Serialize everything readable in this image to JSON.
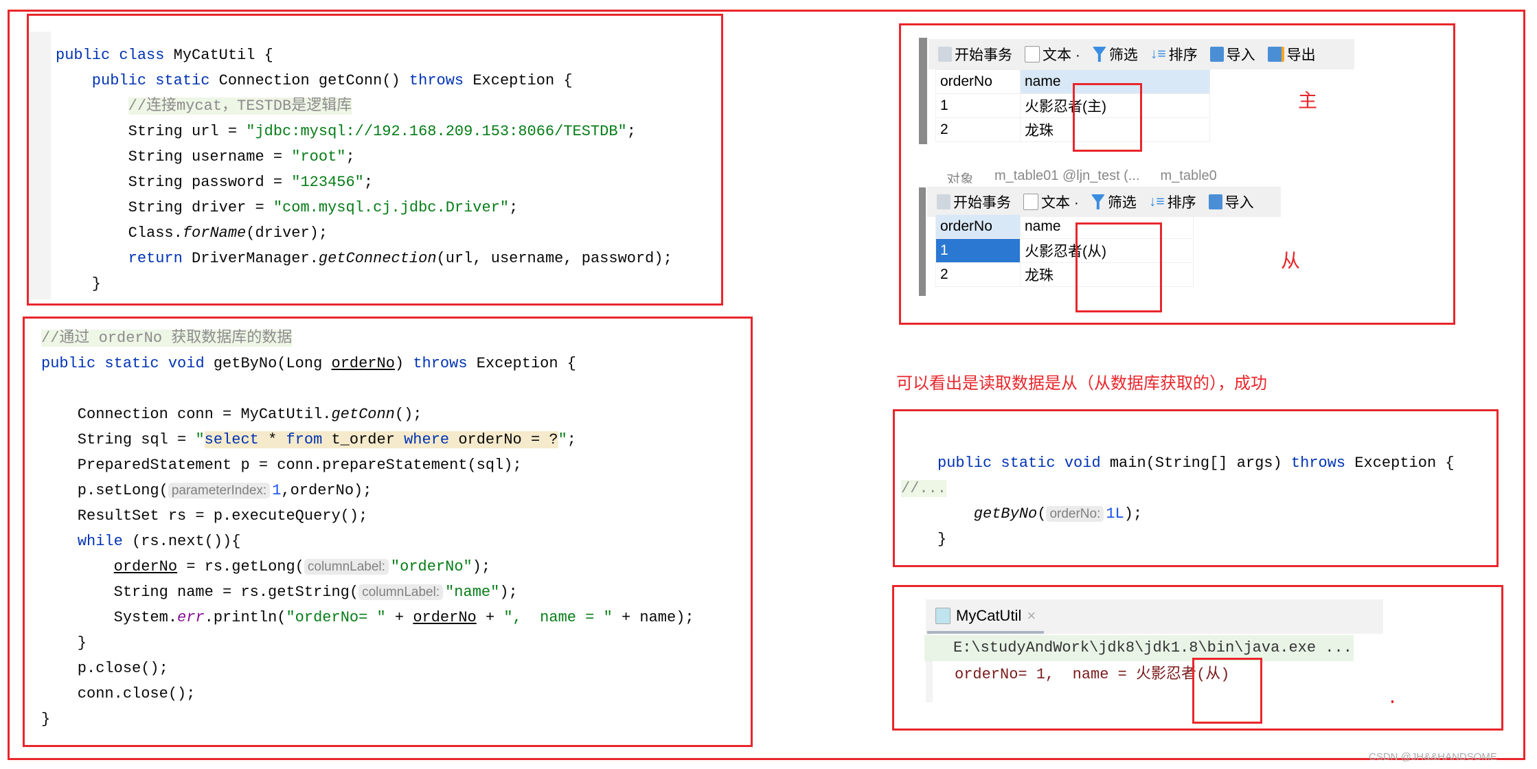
{
  "code1": [
    [
      [
        "public ",
        "kw"
      ],
      [
        "class ",
        "kw"
      ],
      [
        "MyCatUtil {",
        ""
      ]
    ],
    [
      [
        "    public ",
        "kw"
      ],
      [
        "static ",
        "kw"
      ],
      [
        "Connection ",
        ""
      ],
      [
        "getConn",
        "",
        ""
      ],
      [
        "() ",
        ""
      ],
      [
        "throws ",
        "kw"
      ],
      [
        "Exception {",
        ""
      ]
    ],
    [
      [
        "        ",
        ""
      ],
      [
        "//连接mycat，TESTDB是逻辑库",
        "cm cmbg"
      ]
    ],
    [
      [
        "        String url = ",
        ""
      ],
      [
        "\"jdbc:mysql://192.168.209.153:8066/TESTDB\"",
        "str"
      ],
      [
        ";",
        ""
      ]
    ],
    [
      [
        "        String username = ",
        ""
      ],
      [
        "\"root\"",
        "str"
      ],
      [
        ";",
        ""
      ]
    ],
    [
      [
        "        String password = ",
        ""
      ],
      [
        "\"123456\"",
        "str"
      ],
      [
        ";",
        ""
      ]
    ],
    [
      [
        "        String driver = ",
        ""
      ],
      [
        "\"com.mysql.cj.jdbc.Driver\"",
        "str"
      ],
      [
        ";",
        ""
      ]
    ],
    [
      [
        "        Class.",
        ""
      ],
      [
        "forName",
        "it"
      ],
      [
        "(driver);",
        ""
      ]
    ],
    [
      [
        "        ",
        ""
      ],
      [
        "return ",
        "kw"
      ],
      [
        "DriverManager.",
        ""
      ],
      [
        "getConnection",
        "it"
      ],
      [
        "(url, username, password);",
        ""
      ]
    ],
    [
      [
        "    }",
        ""
      ]
    ]
  ],
  "code2": [
    [
      [
        "//通过 orderNo 获取数据库的数据",
        "cm cmbg"
      ]
    ],
    [
      [
        "public ",
        "kw"
      ],
      [
        "static ",
        "kw"
      ],
      [
        "void ",
        "kw"
      ],
      [
        "getByNo(Long ",
        ""
      ],
      [
        "orderNo",
        "ul"
      ],
      [
        ") ",
        ""
      ],
      [
        "throws ",
        "kw"
      ],
      [
        "Exception {",
        ""
      ]
    ],
    [
      [
        "",
        ""
      ]
    ],
    [
      [
        "    Connection conn = MyCatUtil.",
        ""
      ],
      [
        "getConn",
        "it"
      ],
      [
        "();",
        ""
      ]
    ],
    [
      [
        "    String sql = ",
        ""
      ],
      [
        "\"",
        "str"
      ],
      [
        "select ",
        "kw hl"
      ],
      [
        "* ",
        "hl"
      ],
      [
        "from ",
        "kw hl"
      ],
      [
        "t_order ",
        "hl"
      ],
      [
        "where ",
        "kw hl"
      ],
      [
        "orderNo = ?",
        "hl"
      ],
      [
        "\"",
        "str"
      ],
      [
        ";",
        ""
      ]
    ],
    [
      [
        "    PreparedStatement p = conn.prepareStatement(sql);",
        ""
      ]
    ],
    [
      [
        "    p.setLong(",
        ""
      ],
      [
        "parameterIndex:",
        "hint"
      ],
      [
        "1",
        "num"
      ],
      [
        ",orderNo);",
        ""
      ]
    ],
    [
      [
        "    ResultSet rs = p.executeQuery();",
        ""
      ]
    ],
    [
      [
        "    ",
        ""
      ],
      [
        "while ",
        "kw"
      ],
      [
        "(rs.next()){",
        ""
      ]
    ],
    [
      [
        "        ",
        ""
      ],
      [
        "orderNo",
        "ul"
      ],
      [
        " = rs.getLong(",
        ""
      ],
      [
        "columnLabel:",
        "hint"
      ],
      [
        "\"orderNo\"",
        "str"
      ],
      [
        ");",
        ""
      ]
    ],
    [
      [
        "        String name = rs.getString(",
        ""
      ],
      [
        "columnLabel:",
        "hint"
      ],
      [
        "\"name\"",
        "str"
      ],
      [
        ");",
        ""
      ]
    ],
    [
      [
        "        System.",
        ""
      ],
      [
        "err",
        "fld"
      ],
      [
        ".println(",
        ""
      ],
      [
        "\"orderNo= \"",
        "str"
      ],
      [
        " + ",
        ""
      ],
      [
        "orderNo",
        "ul"
      ],
      [
        " + ",
        ""
      ],
      [
        "\",  name = \"",
        "str"
      ],
      [
        " + name);",
        ""
      ]
    ],
    [
      [
        "    }",
        ""
      ]
    ],
    [
      [
        "    p.close();",
        ""
      ]
    ],
    [
      [
        "    conn.close();",
        ""
      ]
    ],
    [
      [
        "}",
        ""
      ]
    ]
  ],
  "code3": [
    [
      [
        "public ",
        "kw"
      ],
      [
        "static ",
        "kw"
      ],
      [
        "void ",
        "kw"
      ],
      [
        "main(String[] args) ",
        ""
      ],
      [
        "throws ",
        "kw"
      ],
      [
        "Exception {",
        ""
      ]
    ],
    [
      [
        "//...",
        "cm cmbg"
      ]
    ],
    [
      [
        "    ",
        ""
      ],
      [
        "getByNo",
        "it"
      ],
      [
        "(",
        ""
      ],
      [
        "orderNo:",
        "hint"
      ],
      [
        "1L",
        "num"
      ],
      [
        ");",
        ""
      ]
    ],
    [
      [
        "}",
        ""
      ]
    ]
  ],
  "db": {
    "toolbar": [
      "开始事务",
      "文本 ·",
      "筛选",
      "排序",
      "导入",
      "导出"
    ],
    "tabs": [
      "对象",
      "m_table01 @ljn_test (...",
      "m_table0"
    ],
    "columns": [
      "orderNo",
      "name"
    ],
    "master_rows": [
      [
        "1",
        "火影忍者(主)"
      ],
      [
        "2",
        "龙珠"
      ]
    ],
    "slave_rows": [
      [
        "1",
        "火影忍者(从)"
      ],
      [
        "2",
        "龙珠"
      ]
    ],
    "master_label": "主",
    "slave_label": "从"
  },
  "note": "可以看出是读取数据是从（从数据库获取的），成功",
  "console": {
    "tab": "MyCatUtil",
    "cmd": "E:\\studyAndWork\\jdk8\\jdk1.8\\bin\\java.exe ...",
    "output_prefix": "orderNo= 1,  name = ",
    "output_value": "火影忍者(从)"
  },
  "watermark": "CSDN @JH&&HANDSOME",
  "colors": {
    "annotation": "#e8262b",
    "selected": "#2a78d2",
    "header": "#d9e8f6"
  }
}
